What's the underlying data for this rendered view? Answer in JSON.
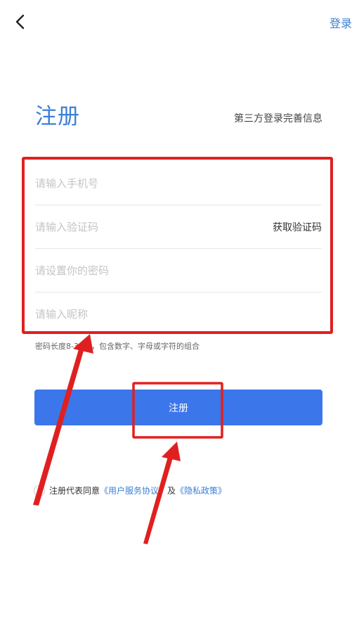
{
  "header": {
    "login_label": "登录"
  },
  "page": {
    "title": "注册",
    "third_party_text": "第三方登录完善信息"
  },
  "form": {
    "phone_placeholder": "请输入手机号",
    "code_placeholder": "请输入验证码",
    "get_code_label": "获取验证码",
    "password_placeholder": "请设置你的密码",
    "nickname_placeholder": "请输入昵称",
    "password_hint": "密码长度8-32位，包含数字、字母或字符的组合"
  },
  "register_button_label": "注册",
  "agreement": {
    "prefix": "注册代表同意",
    "user_agreement": "《用户服务协议》",
    "joiner": "及",
    "privacy_policy": "《隐私政策》"
  },
  "icons": {
    "back": "chevron-left-icon"
  },
  "colors": {
    "accent": "#3b7fd6",
    "button": "#3b76eb",
    "annotation": "#e02020"
  }
}
